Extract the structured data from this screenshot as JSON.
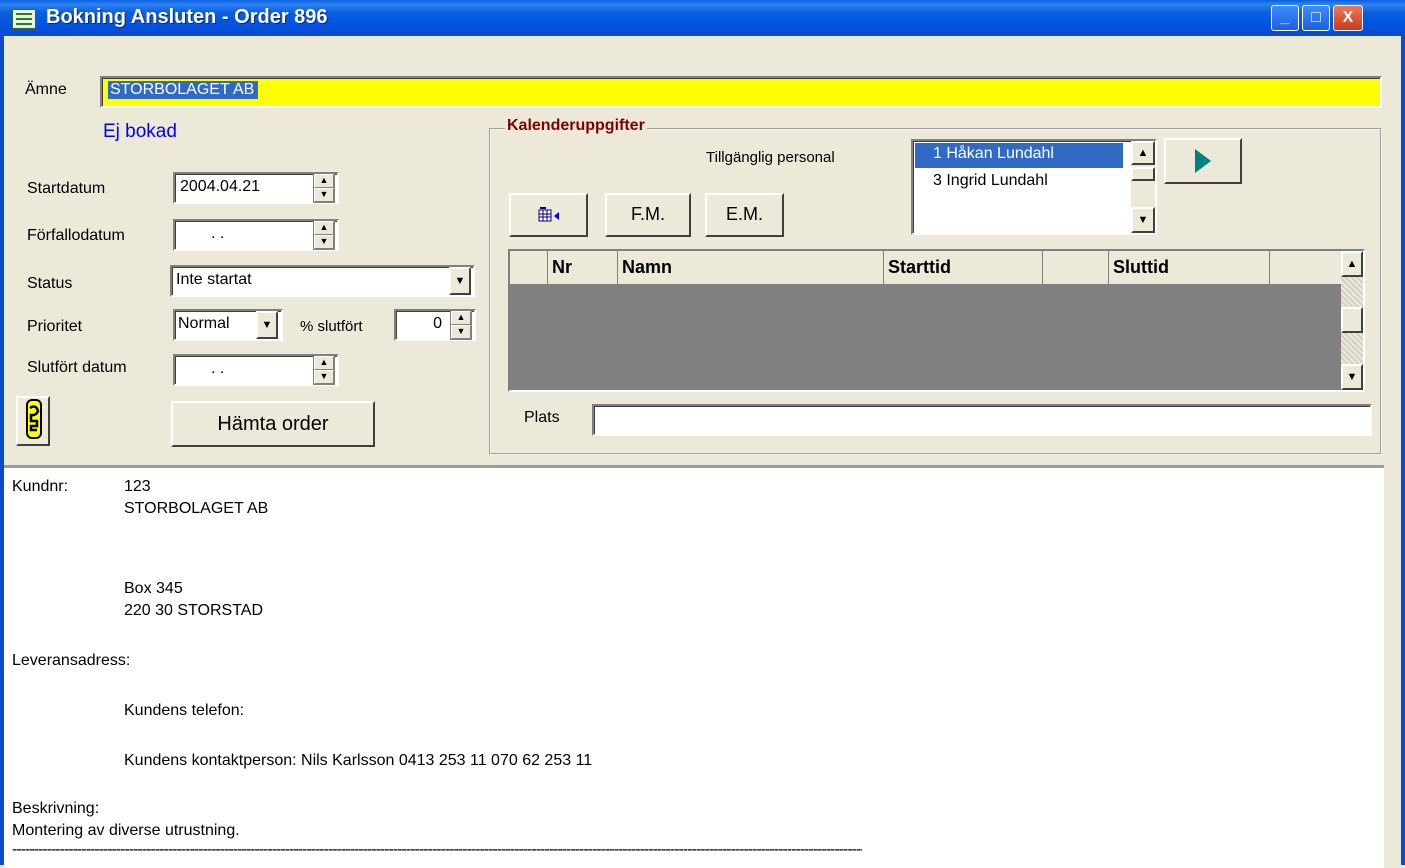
{
  "window": {
    "title": "Bokning Ansluten - Order 896",
    "minimize_label": "_",
    "maximize_label": "□",
    "close_label": "X"
  },
  "subject": {
    "label": "Ämne",
    "value": "STORBOLAGET AB"
  },
  "booking_status": "Ej bokad",
  "form": {
    "start_date_label": "Startdatum",
    "start_date_value": "2004.04.21",
    "due_date_label": "Förfallodatum",
    "due_date_value": " .  .",
    "status_label": "Status",
    "status_value": "Inte startat",
    "priority_label": "Prioritet",
    "priority_value": "Normal",
    "percent_label": "% slutfört",
    "percent_value": "0",
    "completed_date_label": "Slutfört datum",
    "completed_date_value": " .  .",
    "fetch_order_button": "Hämta order"
  },
  "calendar": {
    "group_title": "Kalenderuppgifter",
    "available_staff_label": "Tillgänglig personal",
    "staff": [
      "1 Håkan Lundahl",
      "3 Ingrid Lundahl"
    ],
    "selected_staff_index": 0,
    "fm_button": "F.M.",
    "em_button": "E.M.",
    "grid_columns": [
      "",
      "Nr",
      "Namn",
      "Starttid",
      "",
      "Sluttid",
      ""
    ],
    "place_label": "Plats",
    "place_value": ""
  },
  "details": {
    "customer_no_label": "Kundnr:",
    "customer_no": "123",
    "customer_name": "STORBOLAGET AB",
    "address_line1": "Box 345",
    "address_line2": "220 30  STORSTAD",
    "delivery_address_label": "Leveransadress:",
    "customer_phone_label": "Kundens telefon:",
    "contact_line": "Kundens kontaktperson: Nils Karlsson    0413  253 11   070 62 253 11",
    "description_label": "Beskrivning:",
    "description_text": "Montering av diverse utrustning.",
    "separator": "---------------------------------------------------------------------------------------------------------------------------------------------------------------------------------------------------------------------------------"
  },
  "colors": {
    "title_bar": "#0A5FE0",
    "subject_highlight": "#FFFF00",
    "selection_blue": "#316AC5",
    "status_text": "#0000FF",
    "group_title": "#800000",
    "grid_background": "#808080",
    "play_arrow": "#008080"
  },
  "icons": {
    "app": "table-icon",
    "help": "key-icon",
    "play": "play-icon",
    "grid_tool": "grid-arrow-icon"
  }
}
